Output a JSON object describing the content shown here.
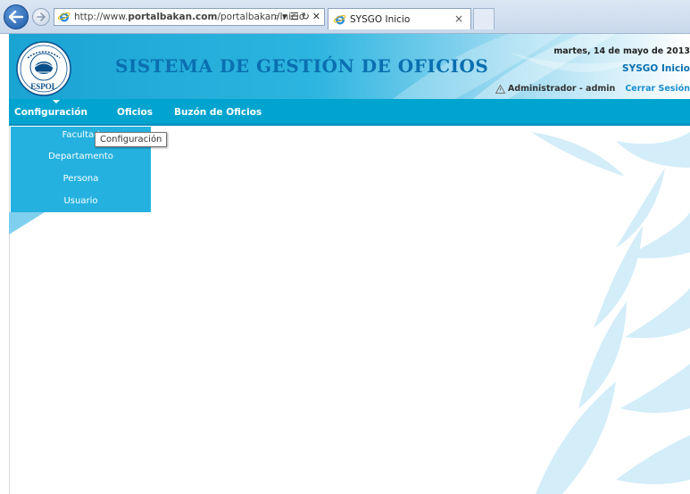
{
  "browser": {
    "url_prefix": "http://www.",
    "url_domain": "portalbakan.com",
    "url_path": "/portalbakan/Inicio",
    "tab_title": "SYSGO Inicio",
    "tab_close": "×"
  },
  "header": {
    "title": "SISTEMA DE GESTIÓN DE OFICIOS",
    "date": "martes, 14 de mayo de 2013",
    "app_name": "SYSGO Inicio",
    "user": "Administrador - admin",
    "logout": "Cerrar Sesión",
    "logo_text": "ESPOL",
    "colors": {
      "accent": "#00a4cf",
      "title": "#0a6fb0"
    }
  },
  "menu": {
    "items": [
      {
        "label": "Configuración"
      },
      {
        "label": "Oficios"
      },
      {
        "label": "Buzón de Oficios"
      }
    ],
    "dropdown": [
      {
        "label": "Facultad"
      },
      {
        "label": "Departamento"
      },
      {
        "label": "Persona"
      },
      {
        "label": "Usuario"
      }
    ],
    "tooltip": "Configuración"
  }
}
